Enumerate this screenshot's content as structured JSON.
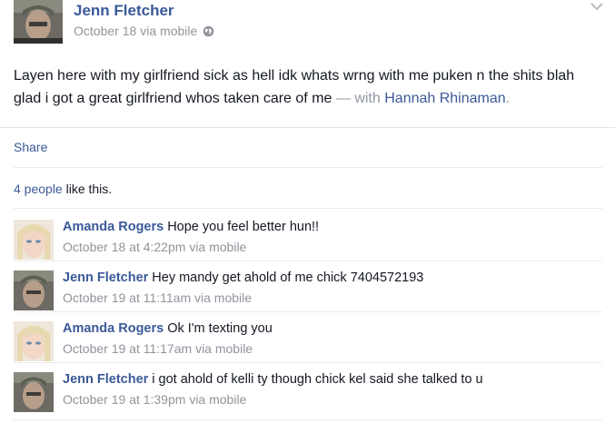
{
  "post": {
    "author": "Jenn Fletcher",
    "timestamp": "October 18",
    "via": "via mobile",
    "body": "Layen here with my girlfriend sick as hell idk whats wrng with me puken n the shits blah glad i got a great girlfriend whos taken care of me",
    "with_prefix": "— with",
    "tagged": "Hannah Rhinaman",
    "tagged_suffix": ".",
    "share_label": "Share",
    "likes_count": "4 people",
    "likes_suffix": "like this.",
    "icons": [
      "globe-icon",
      "chevron-down-icon"
    ]
  },
  "comments": [
    {
      "author": "Amanda Rogers",
      "text": "Hope you feel better hun!!",
      "timestamp": "October 18 at 4:22pm",
      "via": "via mobile"
    },
    {
      "author": "Jenn Fletcher",
      "text": "Hey mandy get ahold of me chick 7404572193",
      "timestamp": "October 19 at 11:11am",
      "via": "via mobile"
    },
    {
      "author": "Amanda Rogers",
      "text": "Ok I'm texting you",
      "timestamp": "October 19 at 11:17am",
      "via": "via mobile"
    },
    {
      "author": "Jenn Fletcher",
      "text": "i got ahold of kelli ty though chick kel said she talked to u",
      "timestamp": "October 19 at 1:39pm",
      "via": "via mobile"
    }
  ],
  "colors": {
    "link": "#3b5998",
    "meta": "#90949c",
    "text": "#141823"
  }
}
